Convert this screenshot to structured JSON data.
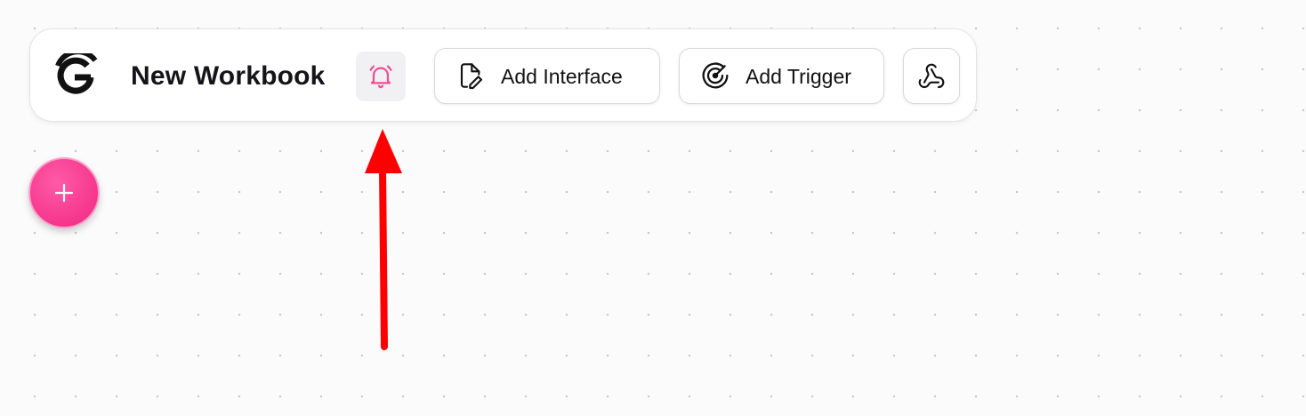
{
  "workbook": {
    "title": "New Workbook"
  },
  "toolbar": {
    "add_interface_label": "Add Interface",
    "add_trigger_label": "Add Trigger"
  },
  "icons": {
    "logo": "g-logo-icon",
    "bell": "bell-ringing-icon",
    "interface": "file-pen-icon",
    "trigger": "radar-icon",
    "webhook": "webhook-icon",
    "add": "plus-icon"
  },
  "colors": {
    "accent_pink": "#f5368c",
    "bell_pink": "#ec4f97",
    "annotation_red": "#ff0000",
    "canvas_background": "#fbfbfb"
  }
}
